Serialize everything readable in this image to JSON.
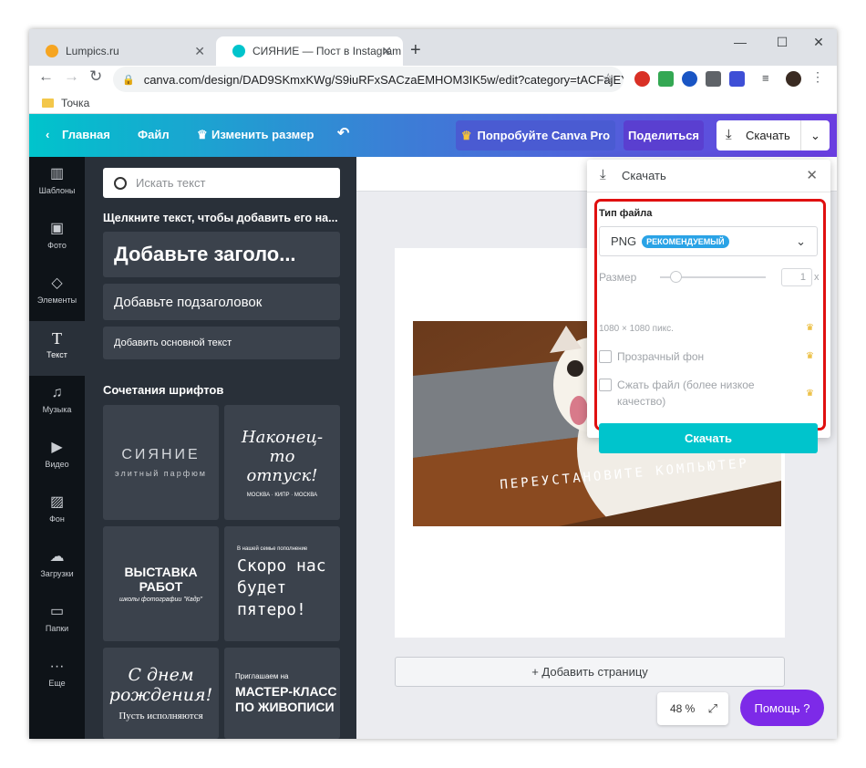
{
  "browser": {
    "tabs": [
      {
        "title": "Lumpics.ru",
        "active": false
      },
      {
        "title": "СИЯНИЕ — Пост в Instagram",
        "active": true
      }
    ],
    "url": "canva.com/design/DAD9SKmxKWg/S9iuRFxSACzaEMHOM3IK5w/edit?category=tACFajEYUAM...",
    "bookmark": "Точка"
  },
  "header": {
    "back_label": "Главная",
    "file_label": "Файл",
    "resize_label": "Изменить размер",
    "try_pro_label": "Попробуйте Canva Pro",
    "share_label": "Поделиться",
    "download_label": "Скачать"
  },
  "sidenav": {
    "items": [
      {
        "label": "Шаблоны",
        "icon": "templates-icon"
      },
      {
        "label": "Фото",
        "icon": "photo-icon"
      },
      {
        "label": "Элементы",
        "icon": "elements-icon"
      },
      {
        "label": "Текст",
        "icon": "text-icon"
      },
      {
        "label": "Музыка",
        "icon": "music-icon"
      },
      {
        "label": "Видео",
        "icon": "video-icon"
      },
      {
        "label": "Фон",
        "icon": "background-icon"
      },
      {
        "label": "Загрузки",
        "icon": "upload-icon"
      },
      {
        "label": "Папки",
        "icon": "folder-icon"
      },
      {
        "label": "Еще",
        "icon": "more-icon"
      }
    ]
  },
  "panel": {
    "search_placeholder": "Искать текст",
    "hint": "Щелкните текст, чтобы добавить его на...",
    "heading": "Добавьте заголо...",
    "subheading": "Добавьте подзаголовок",
    "body_text": "Добавить основной текст",
    "combos_title": "Сочетания шрифтов",
    "combos": [
      {
        "line1": "СИЯНИЕ",
        "line2": "элитный парфюм"
      },
      {
        "line1": "Наконец-то отпуск!",
        "line2": "МОСКВА · КИПР · МОСКВА"
      },
      {
        "line1": "ВЫСТАВКА РАБОТ",
        "line2": "школы фотографии \"Кадр\""
      },
      {
        "line1": "Скоро нас будет пятеро!",
        "line2": "В нашей семье пополнение"
      },
      {
        "line1": "С днем рождения!",
        "line2": "Пусть исполняются"
      },
      {
        "line1": "МАСТЕР-КЛАСС ПО ЖИВОПИСИ",
        "line2": "Приглашаем на"
      }
    ]
  },
  "canvas": {
    "photo_caption": "ПЕРЕУСТАНОВИТЕ КОМПЬЮТЕР",
    "add_page": "+ Добавить страницу",
    "zoom": "48 %",
    "help": "Помощь ?"
  },
  "download_panel": {
    "title": "Скачать",
    "file_type_label": "Тип файла",
    "file_type": "PNG",
    "recommended": "РЕКОМЕНДУЕМЫЙ",
    "size_label": "Размер",
    "size_value": "1",
    "size_multiplier": "x",
    "dimensions": "1080 × 1080 пикс.",
    "transparent_label": "Прозрачный фон",
    "compress_label_1": "Сжать файл (более низкое",
    "compress_label_2": "качество)",
    "button_label": "Скачать"
  },
  "colors": {
    "accent": "#00c4cc",
    "pro_purple": "#7d2ae8",
    "highlight": "#e01010"
  }
}
